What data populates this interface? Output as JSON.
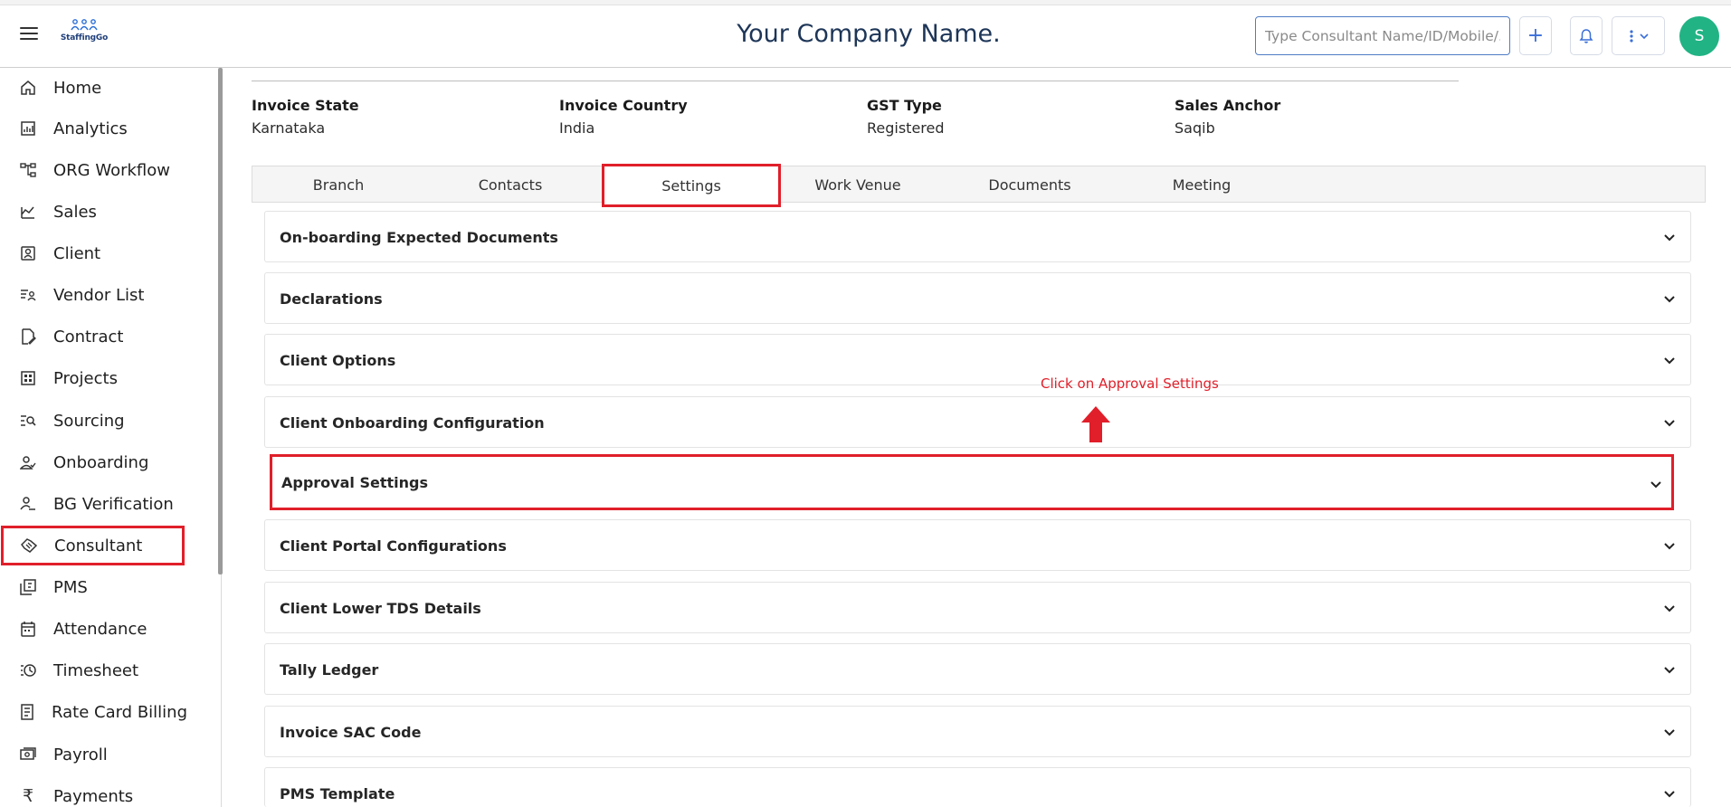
{
  "header": {
    "company_name": "Your Company Name.",
    "logo_text": "StaffingGo",
    "search_placeholder": "Type Consultant Name/ID/Mobile/...",
    "plus_label": "+",
    "avatar_initial": "S"
  },
  "sidebar": {
    "items": [
      {
        "label": "Home",
        "icon": "home-icon"
      },
      {
        "label": "Analytics",
        "icon": "analytics-icon"
      },
      {
        "label": "ORG Workflow",
        "icon": "workflow-icon"
      },
      {
        "label": "Sales",
        "icon": "sales-icon"
      },
      {
        "label": "Client",
        "icon": "client-icon"
      },
      {
        "label": "Vendor List",
        "icon": "vendor-list-icon"
      },
      {
        "label": "Contract",
        "icon": "contract-icon"
      },
      {
        "label": "Projects",
        "icon": "projects-icon"
      },
      {
        "label": "Sourcing",
        "icon": "sourcing-icon"
      },
      {
        "label": "Onboarding",
        "icon": "onboarding-icon"
      },
      {
        "label": "BG Verification",
        "icon": "bg-verification-icon"
      },
      {
        "label": "Consultant",
        "icon": "consultant-icon"
      },
      {
        "label": "PMS",
        "icon": "pms-icon"
      },
      {
        "label": "Attendance",
        "icon": "attendance-icon"
      },
      {
        "label": "Timesheet",
        "icon": "timesheet-icon"
      },
      {
        "label": "Rate Card Billing",
        "icon": "rate-card-icon"
      },
      {
        "label": "Payroll",
        "icon": "payroll-icon"
      },
      {
        "label": "Payments",
        "icon": "rupee-icon"
      }
    ]
  },
  "info": [
    {
      "label": "Invoice State",
      "value": "Karnataka"
    },
    {
      "label": "Invoice Country",
      "value": "India"
    },
    {
      "label": "GST Type",
      "value": "Registered"
    },
    {
      "label": "Sales Anchor",
      "value": "Saqib"
    }
  ],
  "tabs": [
    "Branch",
    "Contacts",
    "Settings",
    "Work Venue",
    "Documents",
    "Meeting"
  ],
  "active_tab": "Settings",
  "sections": [
    "On-boarding Expected Documents",
    "Declarations",
    "Client Options",
    "Client Onboarding Configuration",
    "Approval Settings",
    "Client Portal Configurations",
    "Client Lower TDS Details",
    "Tally Ledger",
    "Invoice SAC Code",
    "PMS Template"
  ],
  "annotation": {
    "text": "Click on Approval Settings",
    "color": "#e01f2a"
  },
  "colors": {
    "accent": "#3a6fd8",
    "highlight": "#e01f2a",
    "avatar": "#21b384",
    "title": "#1d3557"
  }
}
